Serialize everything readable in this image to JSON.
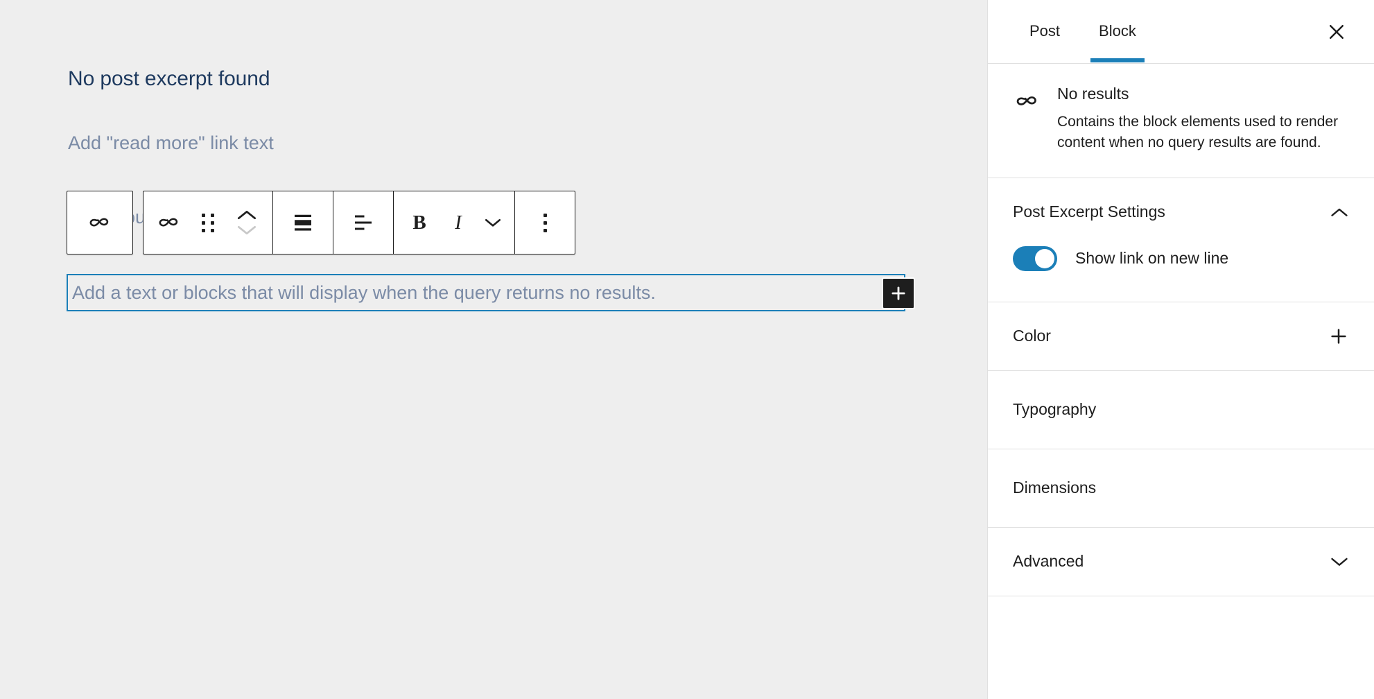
{
  "editor": {
    "excerpt_title": "No post excerpt found",
    "read_more_label": "Add \"read more\" link text",
    "behind_fragment": "ou",
    "selected_block_placeholder": "Add a text or blocks that will display when the query returns no results.",
    "add_block_label": "+",
    "accent_selection_color": "#1b7fb8",
    "canvas_bg": "#eeeeee"
  },
  "toolbar": {
    "parent_block_icon": "no-results-loop-icon",
    "items": [
      {
        "name": "block-type-no-results",
        "icon": "no-results-loop-icon",
        "label": "No results"
      },
      {
        "name": "drag-handle",
        "icon": "drag-dots-icon",
        "label": "Drag"
      },
      {
        "name": "move-up",
        "icon": "chevron-up-icon",
        "label": "Move up"
      },
      {
        "name": "move-down",
        "icon": "chevron-down-icon",
        "label": "Move down"
      },
      {
        "name": "vertical-align",
        "icon": "align-vertical-center-icon",
        "label": "Change vertical alignment"
      },
      {
        "name": "text-align",
        "icon": "align-text-left-icon",
        "label": "Align text"
      },
      {
        "name": "bold",
        "icon": "bold-icon",
        "label": "B"
      },
      {
        "name": "italic",
        "icon": "italic-icon",
        "label": "I"
      },
      {
        "name": "more-rich-text",
        "icon": "chevron-down-icon",
        "label": "More"
      },
      {
        "name": "block-options",
        "icon": "vertical-dots-icon",
        "label": "Options"
      }
    ]
  },
  "sidebar": {
    "tabs": [
      {
        "label": "Post",
        "active": false
      },
      {
        "label": "Block",
        "active": true
      }
    ],
    "close_label": "Close settings",
    "block_info": {
      "icon": "no-results-loop-icon",
      "title": "No results",
      "description": "Contains the block elements used to render content when no query results are found."
    },
    "panels": [
      {
        "title": "Post Excerpt Settings",
        "state": "expanded",
        "chevron": "chevron-up-icon",
        "toggle": {
          "label": "Show link on new line",
          "value": true
        }
      },
      {
        "title": "Color",
        "state": "collapsed",
        "chevron": "plus-icon"
      },
      {
        "title": "Typography",
        "state": "collapsed",
        "chevron": "none"
      },
      {
        "title": "Dimensions",
        "state": "collapsed",
        "chevron": "none"
      },
      {
        "title": "Advanced",
        "state": "collapsed",
        "chevron": "chevron-down-icon"
      }
    ],
    "accent_color": "#1b7fb8"
  }
}
